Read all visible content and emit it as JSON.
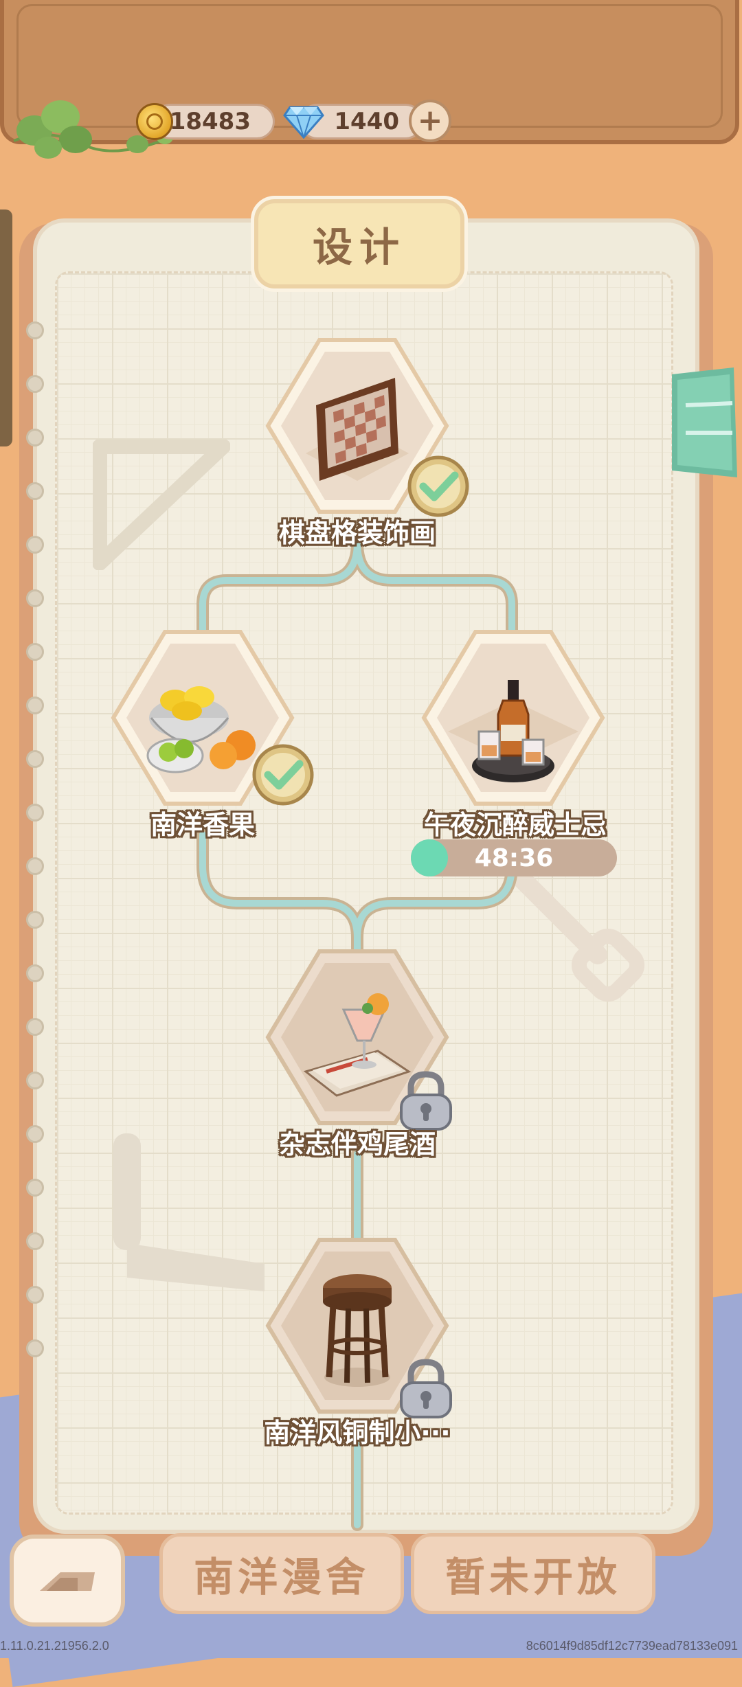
{
  "currency": {
    "coins": "18483",
    "gems": "1440",
    "coin_icon": "cat-coin-icon",
    "gem_icon": "diamond-icon"
  },
  "title": "设计",
  "nodes": [
    {
      "name": "棋盘格装饰画",
      "status": "completed"
    },
    {
      "name": "南洋香果",
      "status": "completed"
    },
    {
      "name": "午夜沉醉威士忌",
      "status": "in-progress",
      "timer": "48:36",
      "progress": 0.18
    },
    {
      "name": "杂志伴鸡尾酒",
      "status": "locked"
    },
    {
      "name": "南洋风铜制小···",
      "status": "locked"
    }
  ],
  "tabs": {
    "current": "南洋漫舍",
    "next": "暂未开放"
  },
  "footer": {
    "version": "1.11.0.21.21956.2.0",
    "hash": "8c6014f9d85df12c7739ead78133e091"
  },
  "colors": {
    "timer_fill": "#6cd9b3",
    "connector": "#9fd2cf",
    "label_outline": "#6f5136"
  }
}
